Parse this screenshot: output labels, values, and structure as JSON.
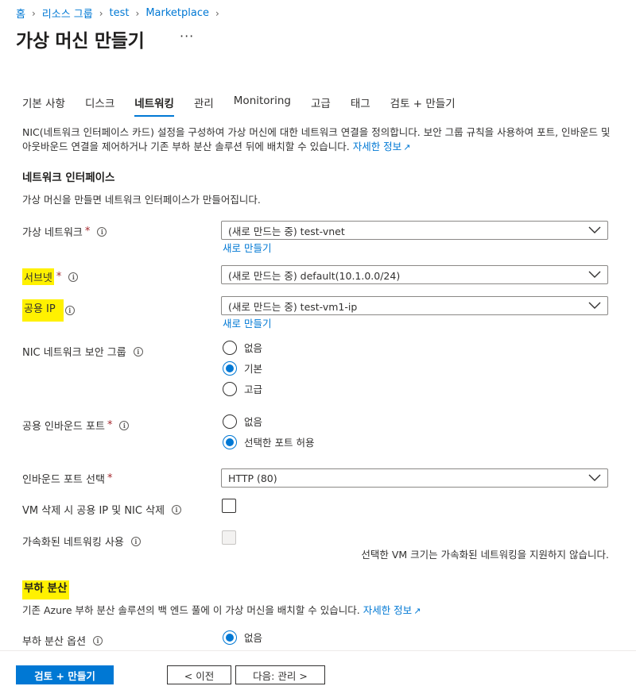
{
  "breadcrumb": [
    "홈",
    "리소스 그룹",
    "test",
    "Marketplace"
  ],
  "page": {
    "title": "가상 머신 만들기",
    "more": "···"
  },
  "tabs": [
    "기본 사항",
    "디스크",
    "네트워킹",
    "관리",
    "Monitoring",
    "고급",
    "태그",
    "검토 + 만들기"
  ],
  "active_tab": "네트워킹",
  "description": {
    "text": "NIC(네트워크 인터페이스 카드) 설정을 구성하여 가상 머신에 대한 네트워크 연결을 정의합니다. 보안 그룹 규칙을 사용하여 포트, 인바운드 및 아웃바운드 연결을 제어하거나 기존 부하 분산 솔루션 뒤에 배치할 수 있습니다.",
    "link": "자세한 정보"
  },
  "nic_section": {
    "title": "네트워크 인터페이스",
    "subtitle": "가상 머신을 만들면 네트워크 인터페이스가 만들어집니다."
  },
  "fields": {
    "vnet": {
      "label": "가상 네트워크",
      "value": "(새로 만드는 중) test-vnet",
      "create": "새로 만들기"
    },
    "subnet": {
      "label": "서브넷",
      "value": "(새로 만드는 중) default(10.1.0.0/24)"
    },
    "public_ip": {
      "label": "공용 IP",
      "value": "(새로 만드는 중) test-vm1-ip",
      "create": "새로 만들기"
    },
    "nsg": {
      "label": "NIC 네트워크 보안 그룹",
      "options": [
        "없음",
        "기본",
        "고급"
      ],
      "selected": "기본"
    },
    "inbound": {
      "label": "공용 인바운드 포트",
      "options": [
        "없음",
        "선택한 포트 허용"
      ],
      "selected": "선택한 포트 허용"
    },
    "ports": {
      "label": "인바운드 포트 선택",
      "value": "HTTP (80)"
    },
    "delete_ip": {
      "label": "VM 삭제 시 공용 IP 및 NIC 삭제",
      "checked": false
    },
    "accel": {
      "label": "가속화된 네트워킹 사용",
      "checked": false,
      "disabled": true,
      "note": "선택한 VM 크기는 가속화된 네트워킹을 지원하지 않습니다."
    }
  },
  "lb_section": {
    "title": "부하 분산",
    "text": "기존 Azure 부하 분산 솔루션의 백 엔드 풀에 이 가상 머신을 배치할 수 있습니다.",
    "link": "자세한 정보",
    "option_label": "부하 분산 옵션",
    "option_value": "없음"
  },
  "footer": {
    "review": "검토 + 만들기",
    "prev": "< 이전",
    "next": "다음: 관리 >"
  },
  "colors": {
    "accent": "#0078d4",
    "highlight": "#fff100",
    "required": "#a4262c"
  }
}
